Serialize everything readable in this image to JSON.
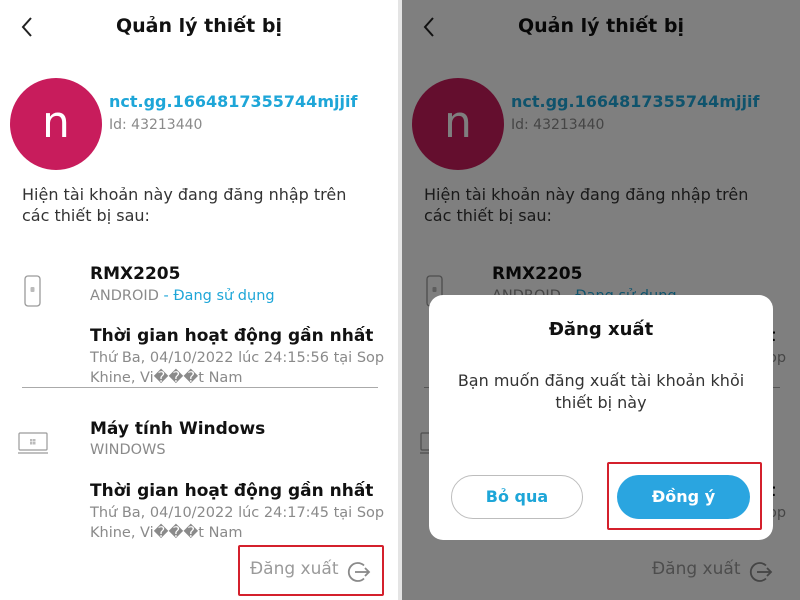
{
  "screen": {
    "title": "Quản lý thiết bị",
    "account": {
      "avatar_letter": "n",
      "username": "nct.gg.1664817355744mjjif",
      "id_text": "Id: 43213440"
    },
    "intro_text": "Hiện tài khoản này đang đăng nhập trên các thiết bị sau:",
    "devices": [
      {
        "icon": "phone-icon",
        "name": "RMX2205",
        "os": "ANDROID",
        "status": " - Đang sử dụng",
        "last_active_label": "Thời gian hoạt động gần nhất",
        "last_active_detail": "Thứ Ba, 04/10/2022 lúc 24:15:56 tại Sop Khine, Vi���t Nam"
      },
      {
        "icon": "desktop-icon",
        "name": "Máy tính Windows",
        "os": "WINDOWS",
        "status": "",
        "last_active_label": "Thời gian hoạt động gần nhất",
        "last_active_detail": "Thứ Ba, 04/10/2022 lúc 24:17:45 tại Sop Khine, Vi���t Nam"
      }
    ],
    "logout_label": "Đăng xuất"
  },
  "dialog": {
    "title": "Đăng xuất",
    "message": "Bạn muốn đăng xuất tài khoản khỏi thiết bị này",
    "cancel_label": "Bỏ qua",
    "confirm_label": "Đồng ý"
  },
  "colors": {
    "accent": "#1ea6d8",
    "avatar": "#c81c5c",
    "highlight": "#d4202c",
    "confirm_button": "#2aa5e0"
  }
}
